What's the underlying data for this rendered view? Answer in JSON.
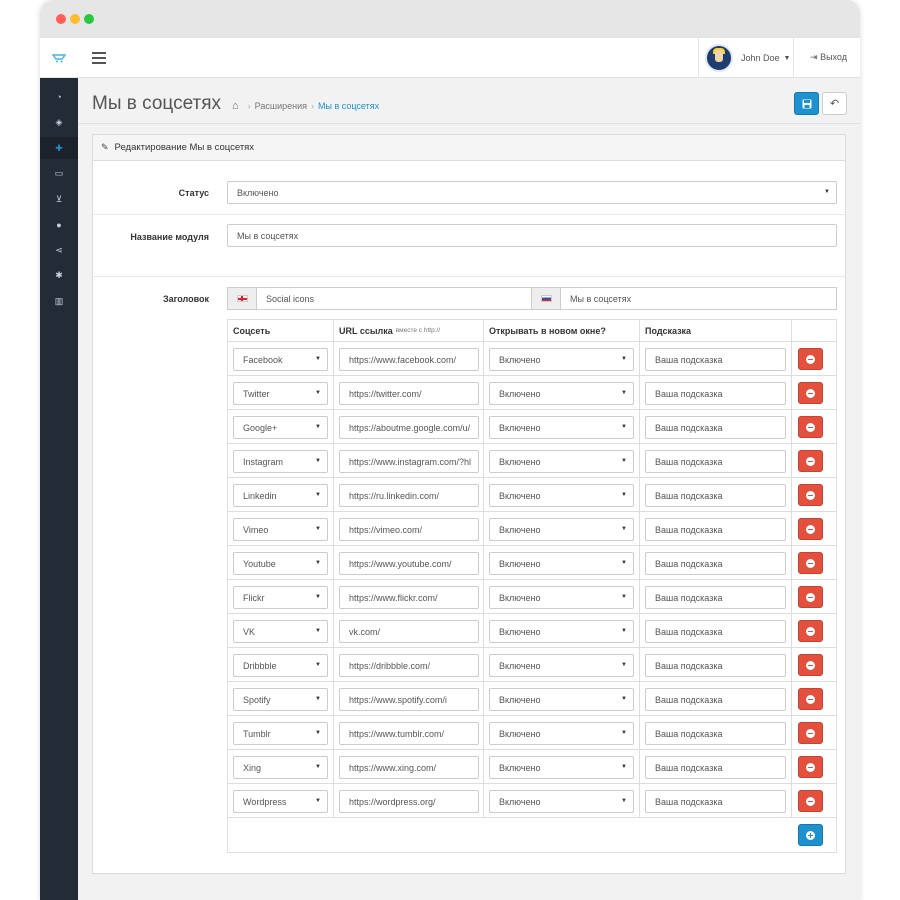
{
  "header": {
    "user_name": "John Doe",
    "logout_label": "Выход"
  },
  "sidebar": {
    "icons": [
      "dashboard-icon",
      "tags-icon",
      "puzzle-icon",
      "desktop-icon",
      "cart-icon",
      "user-icon",
      "share-icon",
      "gear-icon",
      "chart-icon"
    ],
    "active_index": 2
  },
  "page": {
    "title": "Мы в соцсетях",
    "breadcrumb": [
      "Расширения",
      "Мы в соцсетях"
    ]
  },
  "panel": {
    "heading": "Редактирование Мы в соцсетях",
    "status_label": "Статус",
    "status_value": "Включено",
    "module_name_label": "Название модуля",
    "module_name_value": "Мы в соцсетях",
    "title_label": "Заголовок",
    "title_en": "Social icons",
    "title_ru": "Мы в соцсетях"
  },
  "table": {
    "headers": {
      "network": "Соцсеть",
      "url": "URL ссылка",
      "url_hint": "вместе с http://",
      "new_window": "Открывать в новом окне?",
      "tooltip": "Подсказка"
    },
    "rows": [
      {
        "network": "Facebook",
        "url": "https://www.facebook.com/",
        "new_window": "Включено",
        "tooltip": "Ваша подсказка"
      },
      {
        "network": "Twitter",
        "url": "https://twitter.com/",
        "new_window": "Включено",
        "tooltip": "Ваша подсказка"
      },
      {
        "network": "Google+",
        "url": "https://aboutme.google.com/u/",
        "new_window": "Включено",
        "tooltip": "Ваша подсказка"
      },
      {
        "network": "Instagram",
        "url": "https://www.instagram.com/?hl",
        "new_window": "Включено",
        "tooltip": "Ваша подсказка"
      },
      {
        "network": "Linkedin",
        "url": "https://ru.linkedin.com/",
        "new_window": "Включено",
        "tooltip": "Ваша подсказка"
      },
      {
        "network": "Vimeo",
        "url": "https://vimeo.com/",
        "new_window": "Включено",
        "tooltip": "Ваша подсказка"
      },
      {
        "network": "Youtube",
        "url": "https://www.youtube.com/",
        "new_window": "Включено",
        "tooltip": "Ваша подсказка"
      },
      {
        "network": "Flickr",
        "url": "https://www.flickr.com/",
        "new_window": "Включено",
        "tooltip": "Ваша подсказка"
      },
      {
        "network": "VK",
        "url": "vk.com/",
        "new_window": "Включено",
        "tooltip": "Ваша подсказка"
      },
      {
        "network": "Dribbble",
        "url": "https://dribbble.com/",
        "new_window": "Включено",
        "tooltip": "Ваша подсказка"
      },
      {
        "network": "Spotify",
        "url": "https://www.spotify.com/i",
        "new_window": "Включено",
        "tooltip": "Ваша подсказка"
      },
      {
        "network": "Tumblr",
        "url": "https://www.tumblr.com/",
        "new_window": "Включено",
        "tooltip": "Ваша подсказка"
      },
      {
        "network": "Xing",
        "url": "https://www.xing.com/",
        "new_window": "Включено",
        "tooltip": "Ваша подсказка"
      },
      {
        "network": "Wordpress",
        "url": "https://wordpress.org/",
        "new_window": "Включено",
        "tooltip": "Ваша подсказка"
      }
    ]
  },
  "colors": {
    "primary": "#1e91cf",
    "danger": "#e3503e",
    "sidebar": "#232b36"
  }
}
